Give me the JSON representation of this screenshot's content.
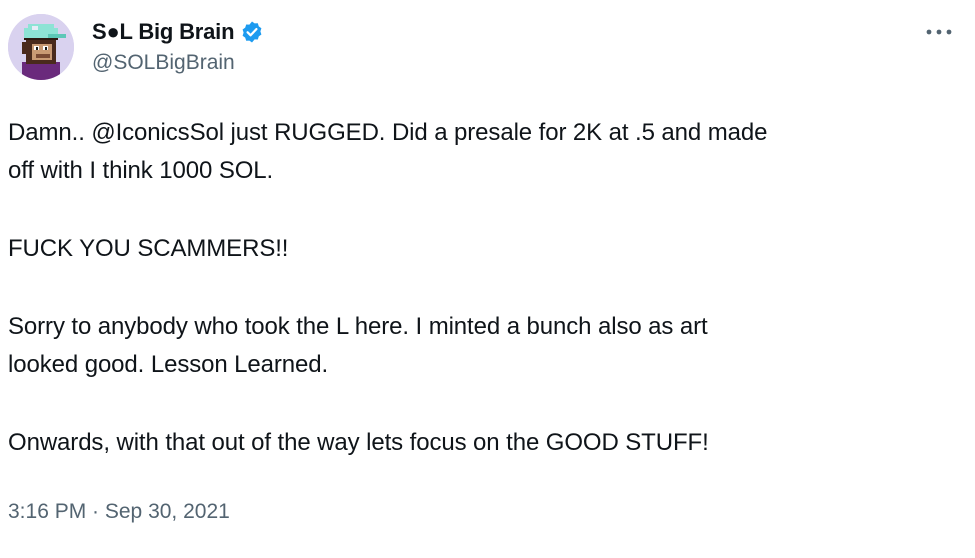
{
  "author": {
    "display_name": "S●L Big Brain",
    "handle": "@SOLBigBrain",
    "verified": true,
    "verified_color": "#1d9bf0",
    "avatar_icon": "pixel-ape-avatar"
  },
  "menu": {
    "more_icon": "more-dots-icon",
    "more_glyph": "···"
  },
  "tweet": {
    "para1_prefix": "Damn.. ",
    "para1_mention": "@IconicsSol",
    "para1_line1_rest": " just RUGGED. Did a presale for 2K at .5 and made",
    "para1_line2": "off with I think 1000 SOL.",
    "para2": "FUCK YOU SCAMMERS!!",
    "para3_line1": "Sorry to anybody who took the L here. I minted a bunch also as art",
    "para3_line2": "looked good. Lesson Learned.",
    "para4": "Onwards, with that out of the way lets focus on the GOOD STUFF!"
  },
  "meta": {
    "timestamp": "3:16 PM · Sep 30, 2021"
  },
  "colors": {
    "text_primary": "#0f1419",
    "text_secondary": "#536471",
    "background": "#ffffff"
  }
}
